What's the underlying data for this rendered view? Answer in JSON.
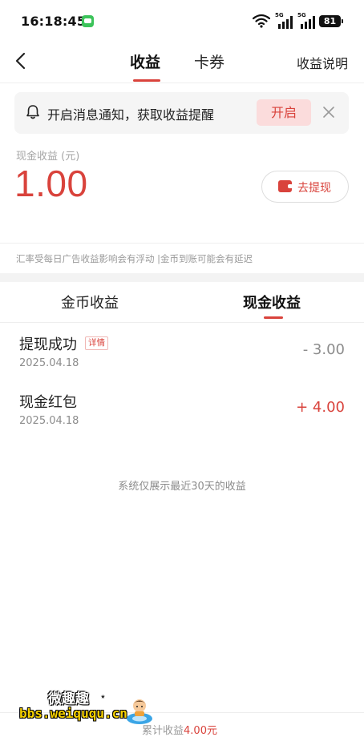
{
  "status_bar": {
    "time": "16:18:45",
    "network_1": "5G",
    "network_2": "5G",
    "battery": "81"
  },
  "header": {
    "tabs": [
      {
        "label": "收益",
        "active": true
      },
      {
        "label": "卡券",
        "active": false
      }
    ],
    "help_label": "收益说明"
  },
  "notification": {
    "text": "开启消息通知，获取收益提醒",
    "enable_label": "开启"
  },
  "balance": {
    "label": "现金收益 (元)",
    "amount": "1.00",
    "withdraw_label": "去提现"
  },
  "disclaimer": "汇率受每日广告收益影响会有浮动 |金币到账可能会有延迟",
  "segment_tabs": [
    {
      "label": "金币收益",
      "active": false
    },
    {
      "label": "现金收益",
      "active": true
    }
  ],
  "records": [
    {
      "title": "提现成功",
      "tag": "详情",
      "date": "2025.04.18",
      "amount": "- 3.00",
      "kind": "negative"
    },
    {
      "title": "现金红包",
      "tag": "",
      "date": "2025.04.18",
      "amount": "+ 4.00",
      "kind": "positive"
    }
  ],
  "footnote": "系统仅展示最近30天的收益",
  "total": {
    "label": "累计收益",
    "value": "4.00元"
  },
  "watermark": {
    "title": "微趣趣",
    "star": "⋆",
    "url": "bbs.weiququ.cn"
  },
  "colors": {
    "accent": "#d9433c",
    "accent_light": "#fbdcdc",
    "muted": "#8c8c8c"
  },
  "icons": [
    "back-arrow-icon",
    "bell-icon",
    "close-icon",
    "wallet-icon",
    "wifi-icon",
    "message-icon"
  ]
}
